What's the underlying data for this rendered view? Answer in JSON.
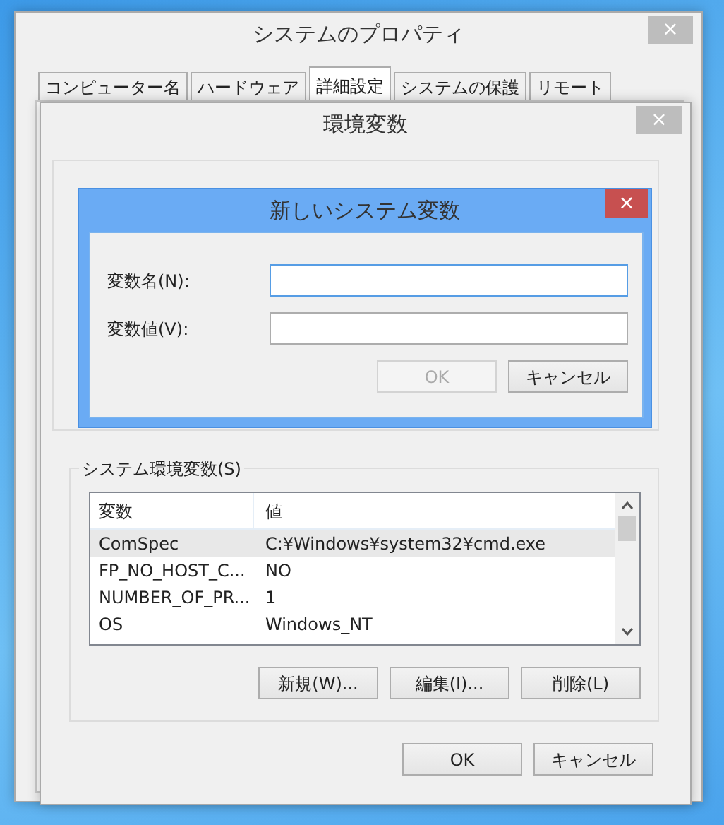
{
  "system_properties": {
    "title": "システムのプロパティ",
    "close": "×",
    "tabs": [
      {
        "label": "コンピューター名",
        "selected": false
      },
      {
        "label": "ハードウェア",
        "selected": false
      },
      {
        "label": "詳細設定",
        "selected": true
      },
      {
        "label": "システムの保護",
        "selected": false
      },
      {
        "label": "リモート",
        "selected": false
      }
    ]
  },
  "environment_variables": {
    "title": "環境変数",
    "close": "×",
    "system_group": {
      "title": "システム環境変数(S)",
      "columns": [
        "変数",
        "値"
      ],
      "rows": [
        {
          "name": "ComSpec",
          "value": "C:¥Windows¥system32¥cmd.exe",
          "selected": true
        },
        {
          "name": "FP_NO_HOST_C...",
          "value": "NO",
          "selected": false
        },
        {
          "name": "NUMBER_OF_PR...",
          "value": "1",
          "selected": false
        },
        {
          "name": "OS",
          "value": "Windows_NT",
          "selected": false
        }
      ],
      "buttons": [
        "新規(W)...",
        "編集(I)...",
        "削除(L)"
      ]
    },
    "buttons": [
      "OK",
      "キャンセル"
    ]
  },
  "new_system_variable": {
    "title": "新しいシステム変数",
    "close": "×",
    "fields": [
      {
        "label": "変数名(N):",
        "focused": true
      },
      {
        "label": "変数値(V):",
        "focused": false
      }
    ],
    "buttons": [
      {
        "label": "OK",
        "disabled": true
      },
      {
        "label": "キャンセル",
        "disabled": false
      }
    ]
  }
}
